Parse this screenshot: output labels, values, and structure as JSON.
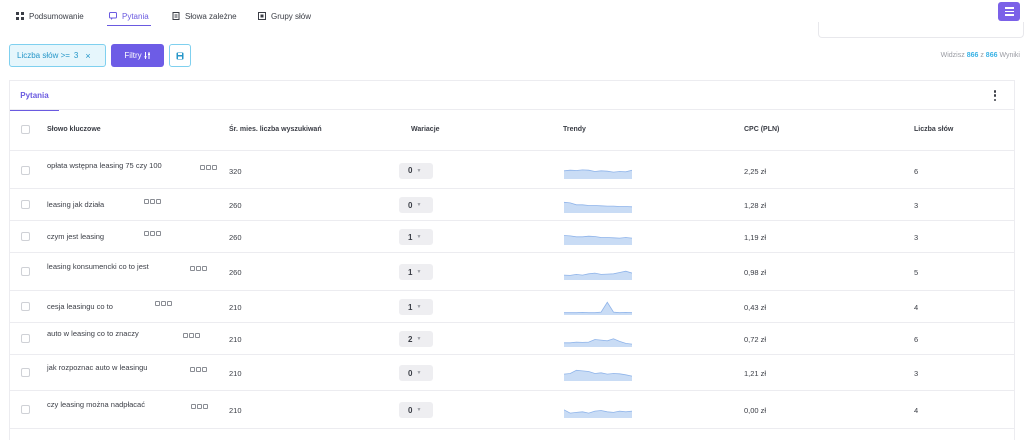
{
  "nav": {
    "tabs": [
      {
        "label": "Podsumowanie",
        "icon": "summary-icon"
      },
      {
        "label": "Pytania",
        "icon": "question-icon",
        "active": true
      },
      {
        "label": "Słowa zależne",
        "icon": "dependent-words-icon"
      },
      {
        "label": "Grupy słów",
        "icon": "word-groups-icon"
      }
    ]
  },
  "toolbar": {
    "filter_chip": {
      "label": "Liczba słów >=",
      "value": "3",
      "close": "×"
    },
    "filters_button": "Filtry",
    "save_icon": "save-icon"
  },
  "results": {
    "prefix": "Widzisz",
    "shown": "866",
    "mid": "z",
    "total": "866",
    "suffix": "Wyniki"
  },
  "card": {
    "tab": "Pytania",
    "columns": {
      "keyword": "Słowo kluczowe",
      "volume": "Śr. mies. liczba wyszukiwań",
      "variations": "Wariacje",
      "trends": "Trendy",
      "cpc": "CPC (PLN)",
      "words": "Liczba słów"
    },
    "rows": [
      {
        "keyword": "opłata wstępna leasing 75 czy 100",
        "volume": "320",
        "variations": "0",
        "trend": [
          0.55,
          0.6,
          0.58,
          0.62,
          0.6,
          0.5,
          0.55,
          0.52,
          0.45,
          0.5,
          0.48,
          0.6
        ],
        "cpc": "2,25 zł",
        "words": "6"
      },
      {
        "keyword": "leasing jak działa",
        "volume": "260",
        "variations": "0",
        "trend": [
          0.75,
          0.7,
          0.55,
          0.55,
          0.5,
          0.5,
          0.48,
          0.45,
          0.45,
          0.42,
          0.42,
          0.4
        ],
        "cpc": "1,28 zł",
        "words": "3"
      },
      {
        "keyword": "czym jest leasing",
        "volume": "260",
        "variations": "1",
        "trend": [
          0.65,
          0.62,
          0.55,
          0.55,
          0.6,
          0.58,
          0.5,
          0.5,
          0.48,
          0.45,
          0.5,
          0.45
        ],
        "cpc": "1,19 zł",
        "words": "3"
      },
      {
        "keyword": "leasing konsumencki co to jest",
        "volume": "260",
        "variations": "1",
        "trend": [
          0.3,
          0.28,
          0.35,
          0.3,
          0.4,
          0.45,
          0.35,
          0.38,
          0.4,
          0.5,
          0.6,
          0.45
        ],
        "cpc": "0,98 zł",
        "words": "5"
      },
      {
        "keyword": "cesja leasingu co to",
        "volume": "210",
        "variations": "1",
        "trend": [
          0.1,
          0.1,
          0.1,
          0.12,
          0.1,
          0.1,
          0.15,
          0.9,
          0.15,
          0.1,
          0.12,
          0.1
        ],
        "cpc": "0,43 zł",
        "words": "4"
      },
      {
        "keyword": "auto w leasing co to znaczy",
        "volume": "210",
        "variations": "2",
        "trend": [
          0.25,
          0.25,
          0.3,
          0.28,
          0.3,
          0.5,
          0.45,
          0.4,
          0.55,
          0.35,
          0.2,
          0.15
        ],
        "cpc": "0,72 zł",
        "words": "6"
      },
      {
        "keyword": "jak rozpoznac auto w leasingu",
        "volume": "210",
        "variations": "0",
        "trend": [
          0.45,
          0.5,
          0.75,
          0.7,
          0.65,
          0.5,
          0.55,
          0.45,
          0.5,
          0.48,
          0.4,
          0.3
        ],
        "cpc": "1,21 zł",
        "words": "3"
      },
      {
        "keyword": "czy leasing można nadpłacać",
        "volume": "210",
        "variations": "0",
        "trend": [
          0.55,
          0.3,
          0.35,
          0.4,
          0.3,
          0.45,
          0.5,
          0.4,
          0.35,
          0.45,
          0.4,
          0.45
        ],
        "cpc": "0,00 zł",
        "words": "4"
      }
    ]
  },
  "colors": {
    "accent": "#6a5ae0",
    "info": "#3bb3e6",
    "trend_fill": "#c9dcf5",
    "trend_line": "#8fb4ea"
  }
}
